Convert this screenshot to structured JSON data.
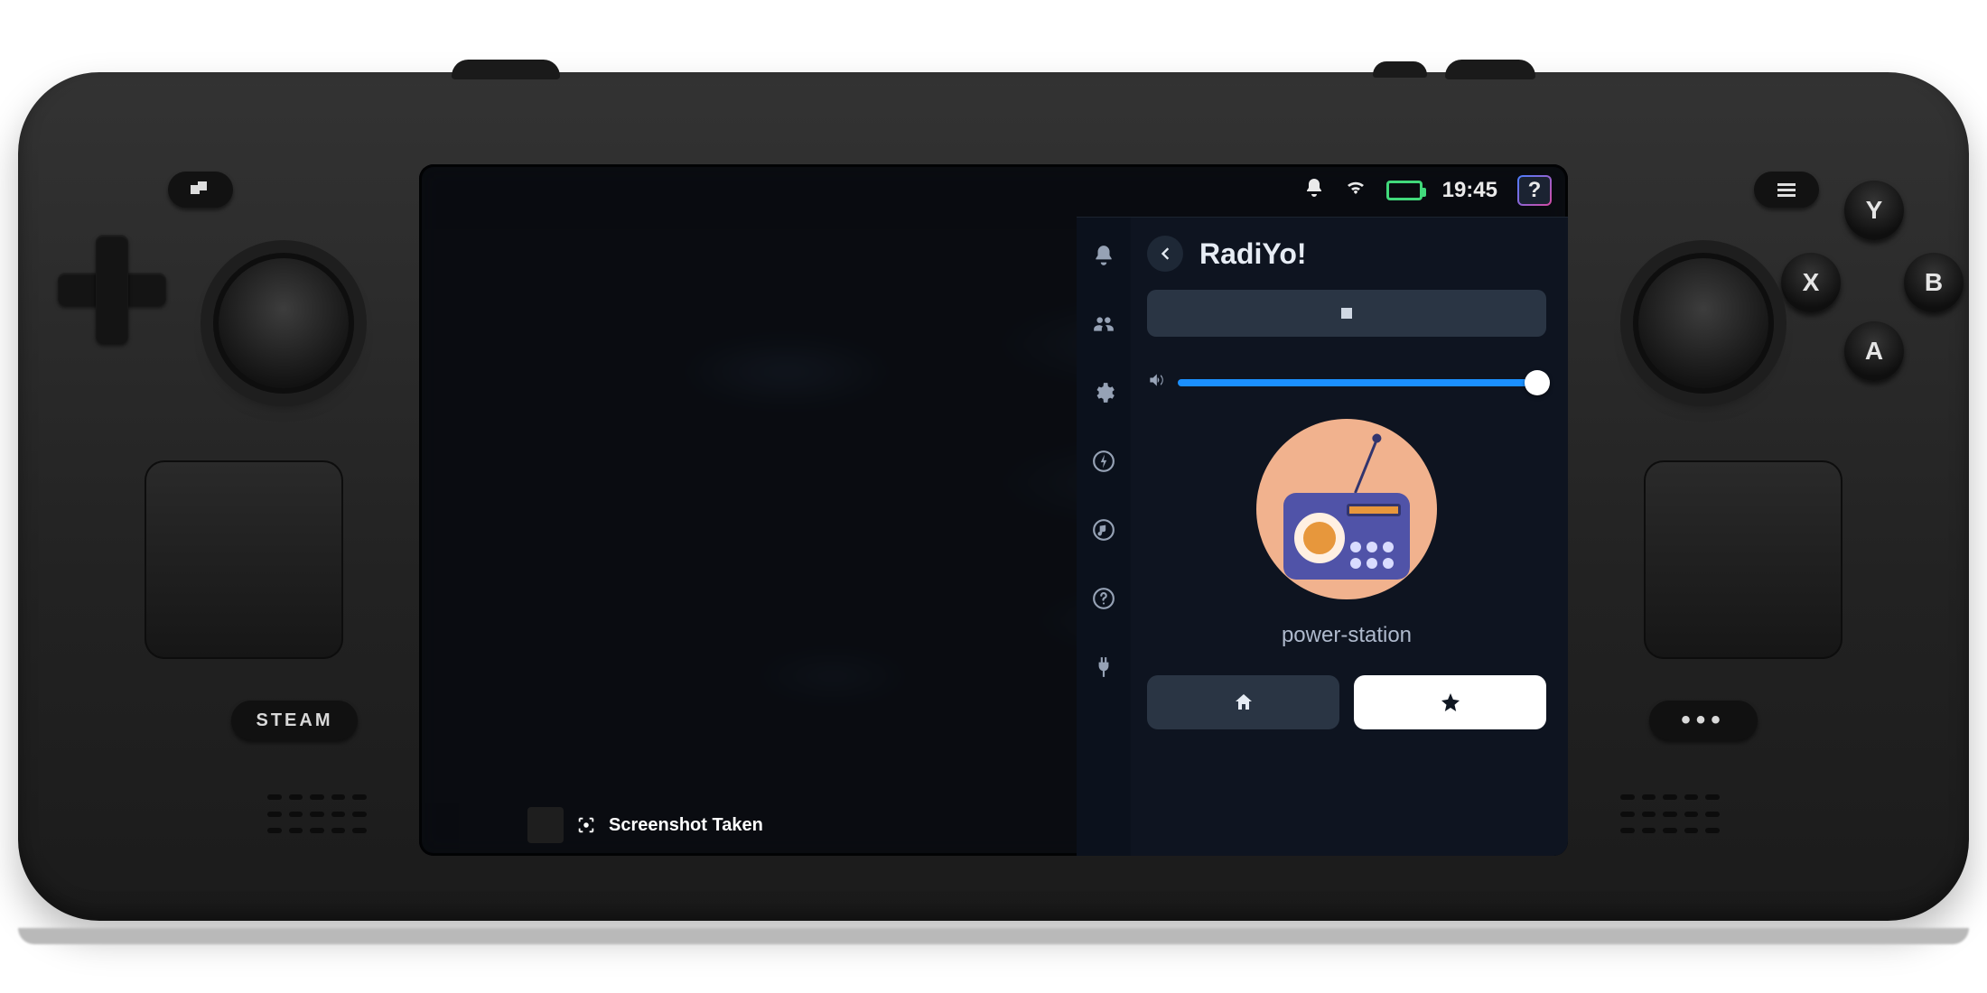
{
  "statusbar": {
    "time": "19:45",
    "help_label": "?"
  },
  "sidebar_icons": [
    "bell",
    "friends",
    "gear",
    "bolt",
    "music",
    "help",
    "plug"
  ],
  "panel": {
    "title": "RadiYo!",
    "station_name": "power-station",
    "volume_percent": 100
  },
  "tabs": {
    "home_icon": "home",
    "fav_icon": "star"
  },
  "toast": {
    "text": "Screenshot Taken"
  },
  "device": {
    "steam_label": "STEAM",
    "dots_label": "•••",
    "buttons": {
      "y": "Y",
      "x": "X",
      "b": "B",
      "a": "A"
    }
  }
}
